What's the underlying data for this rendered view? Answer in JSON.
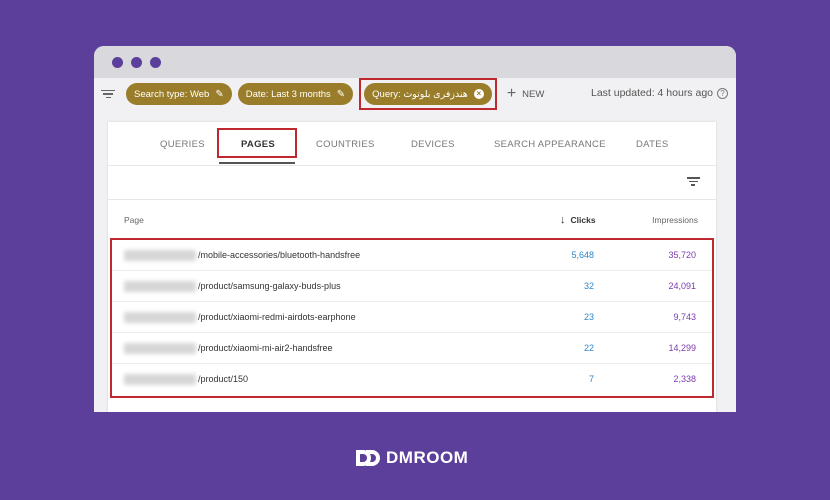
{
  "filterbar": {
    "chips": [
      {
        "label": "Search type: Web"
      },
      {
        "label": "Date: Last 3 months"
      }
    ],
    "query_chip": {
      "label": "Query: هندزفری بلوتوث"
    },
    "new_label": "NEW",
    "last_updated": "Last updated: 4 hours ago"
  },
  "tabs": [
    {
      "label": "QUERIES"
    },
    {
      "label": "PAGES"
    },
    {
      "label": "COUNTRIES"
    },
    {
      "label": "DEVICES"
    },
    {
      "label": "SEARCH APPEARANCE"
    },
    {
      "label": "DATES"
    }
  ],
  "table": {
    "headers": {
      "page": "Page",
      "clicks": "Clicks",
      "impressions": "Impressions"
    },
    "rows": [
      {
        "path": "/mobile-accessories/bluetooth-handsfree",
        "clicks": "5,648",
        "impressions": "35,720"
      },
      {
        "path": "/product/samsung-galaxy-buds-plus",
        "clicks": "32",
        "impressions": "24,091"
      },
      {
        "path": "/product/xiaomi-redmi-airdots-earphone",
        "clicks": "23",
        "impressions": "9,743"
      },
      {
        "path": "/product/xiaomi-mi-air2-handsfree",
        "clicks": "22",
        "impressions": "14,299"
      },
      {
        "path": "/product/150",
        "clicks": "7",
        "impressions": "2,338"
      }
    ]
  },
  "brand": {
    "name": "DMROOM"
  },
  "colors": {
    "background": "#5b3f9a",
    "chip": "#9a7d2a",
    "highlight": "#c0282f",
    "clicks": "#2f86c9",
    "impressions": "#7b3bb0"
  }
}
